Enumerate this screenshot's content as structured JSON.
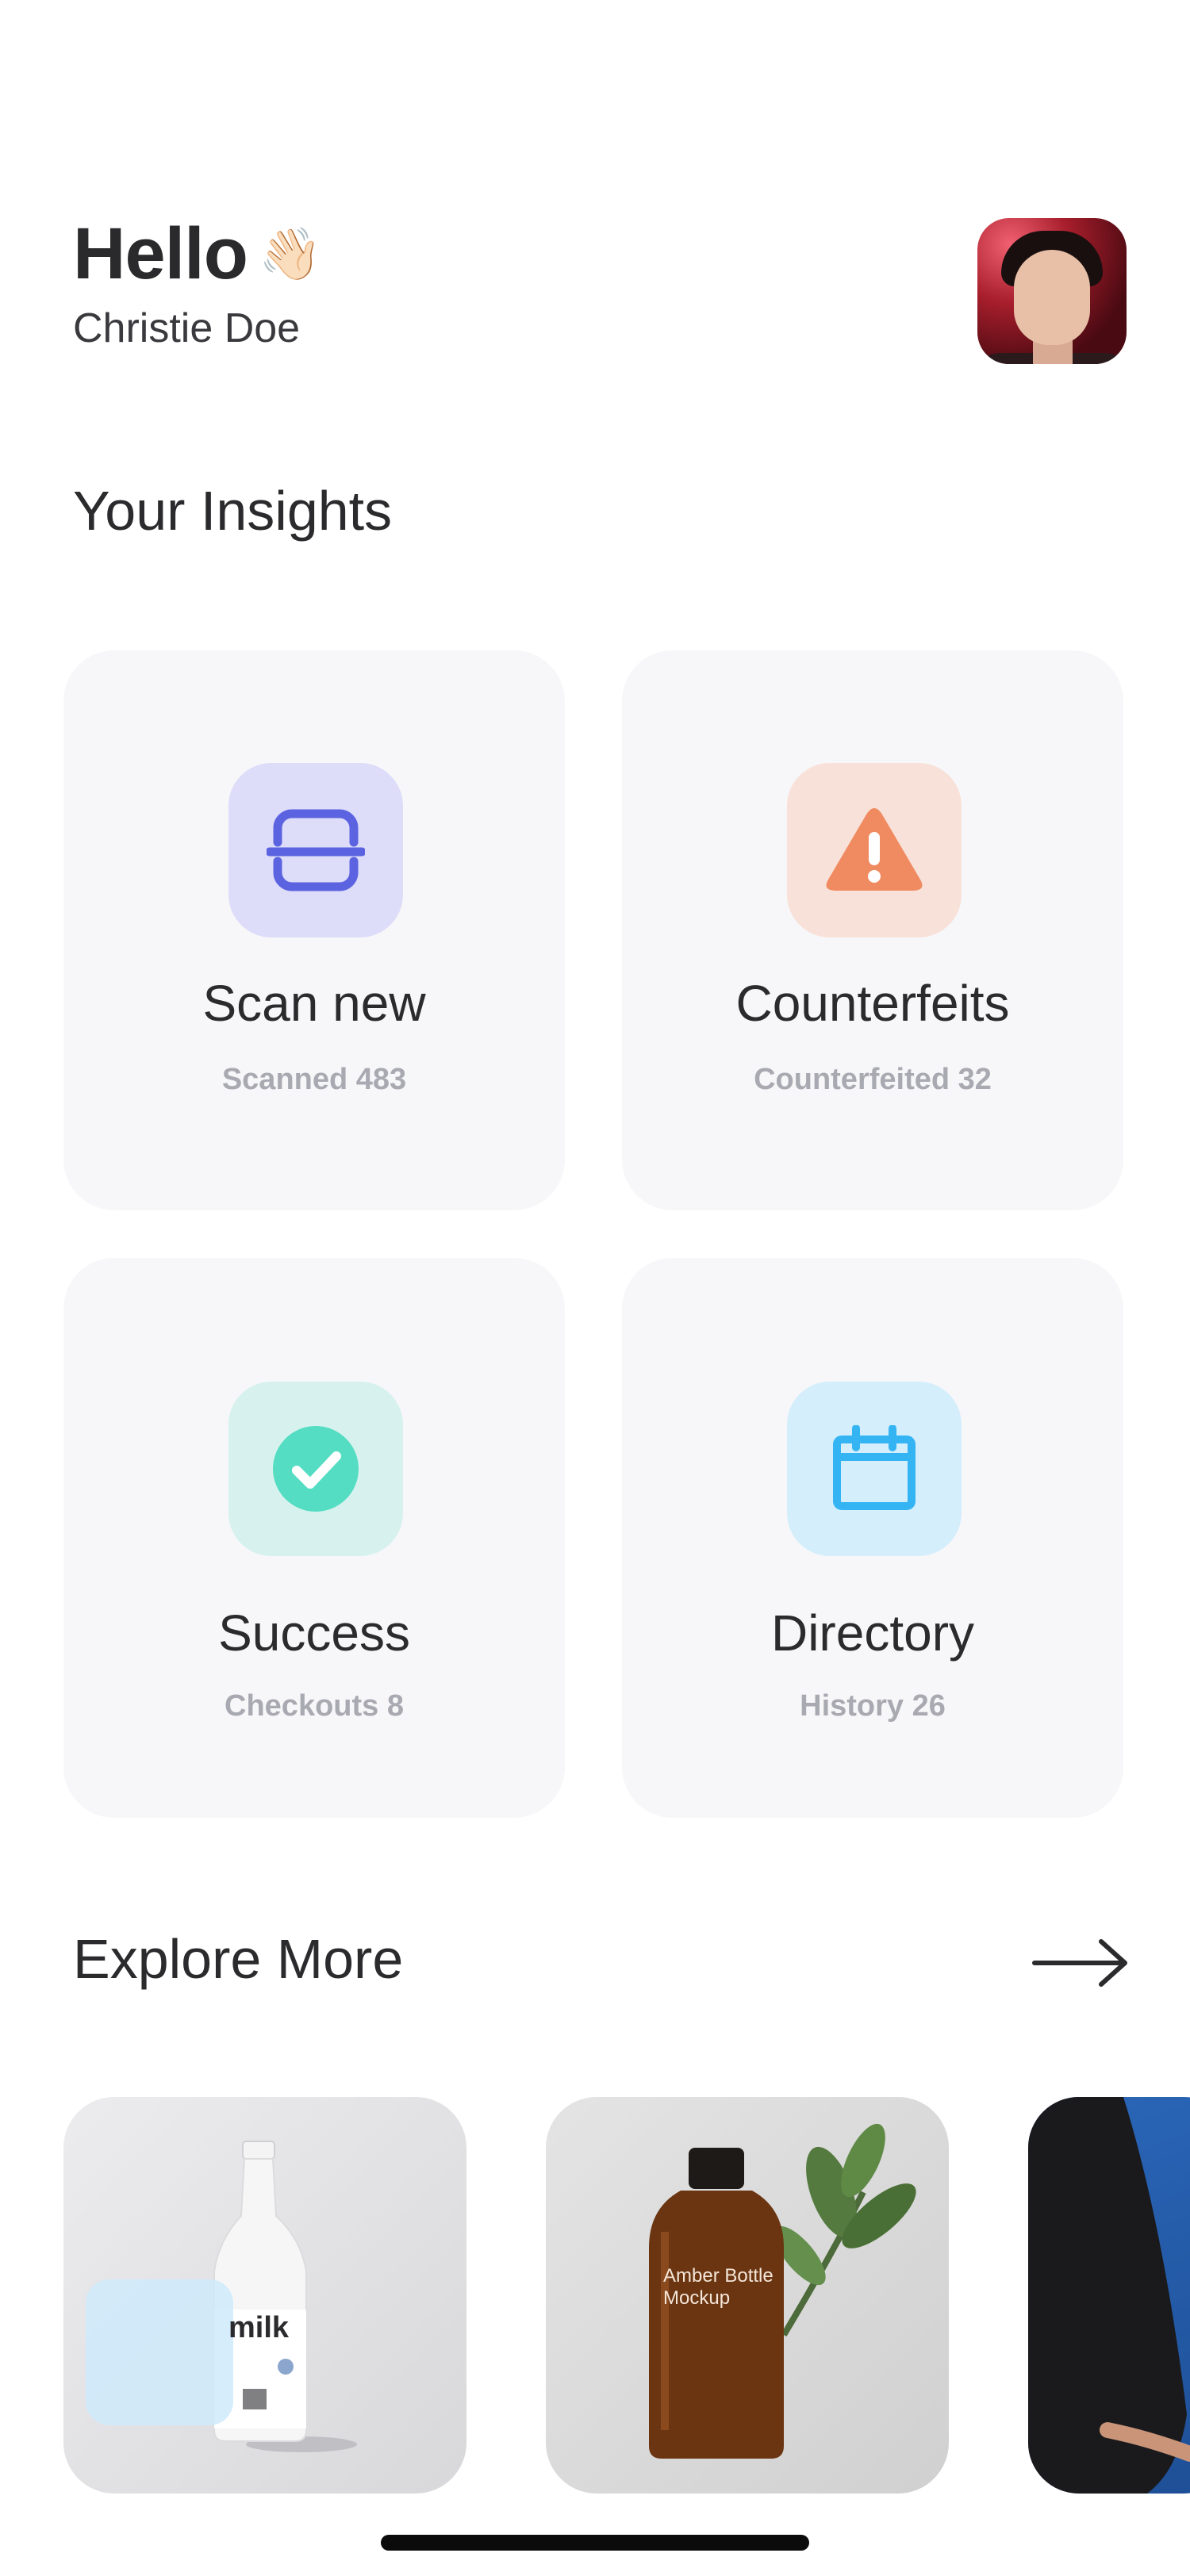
{
  "header": {
    "greeting": "Hello",
    "wave_emoji": "👋🏻",
    "username": "Christie Doe",
    "avatar": "profile-photo"
  },
  "insights": {
    "title": "Your Insights",
    "cards": [
      {
        "title": "Scan new",
        "subtitle": "Scanned 483",
        "icon": "scan-icon",
        "icon_color": "#5b63e0",
        "bg_color": "#dddcf9"
      },
      {
        "title": "Counterfeits",
        "subtitle": "Counterfeited 32",
        "icon": "warning-icon",
        "icon_color": "#f08a60",
        "bg_color": "#f8e1d8"
      },
      {
        "title": "Success",
        "subtitle": "Checkouts 8",
        "icon": "check-circle-icon",
        "icon_color": "#54ddc3",
        "bg_color": "#d7f2ee"
      },
      {
        "title": "Directory",
        "subtitle": "History 26",
        "icon": "calendar-icon",
        "icon_color": "#35b4f4",
        "bg_color": "#d4eefc"
      }
    ]
  },
  "explore": {
    "title": "Explore More",
    "arrow_icon": "arrow-right-icon",
    "items": [
      {
        "name": "milk-bottle-mockup",
        "label": "milk"
      },
      {
        "name": "amber-bottle-mockup",
        "label": "Amber Bottle Mockup"
      },
      {
        "name": "tshirt-mockup"
      }
    ]
  },
  "colors": {
    "card_bg": "#f7f7f9",
    "subtitle": "#a9a9b2",
    "text": "#2b2b2e"
  }
}
